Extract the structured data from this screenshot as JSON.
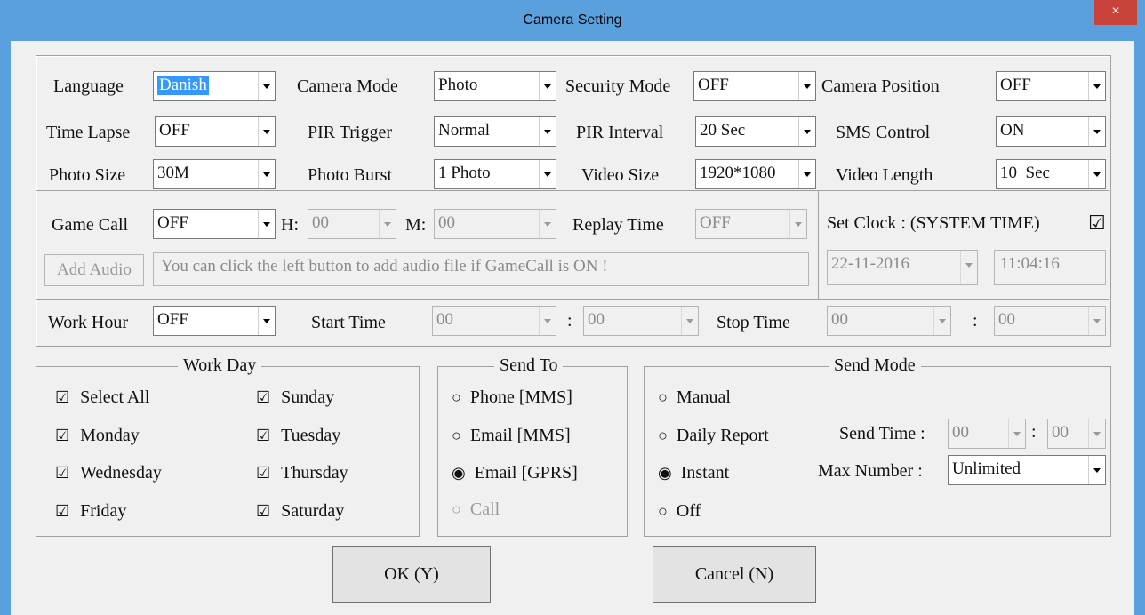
{
  "window": {
    "title": "Camera Setting",
    "close_glyph": "×"
  },
  "settings": {
    "language": {
      "label": "Language",
      "value": "Danish"
    },
    "camera_mode": {
      "label": "Camera Mode",
      "value": "Photo"
    },
    "security_mode": {
      "label": "Security Mode",
      "value": "OFF"
    },
    "camera_position": {
      "label": "Camera Position",
      "value": "OFF"
    },
    "time_lapse": {
      "label": "Time Lapse",
      "value": "OFF"
    },
    "pir_trigger": {
      "label": "PIR Trigger",
      "value": "Normal"
    },
    "pir_interval": {
      "label": "PIR Interval",
      "value": "20 Sec"
    },
    "sms_control": {
      "label": "SMS Control",
      "value": "ON"
    },
    "photo_size": {
      "label": "Photo Size",
      "value": "30M"
    },
    "photo_burst": {
      "label": "Photo Burst",
      "value": "1 Photo"
    },
    "video_size": {
      "label": "Video Size",
      "value": "1920*1080"
    },
    "video_length": {
      "label": "Video Length",
      "value": "10  Sec"
    }
  },
  "game_call": {
    "label": "Game Call",
    "value": "OFF",
    "h_label": "H:",
    "h_value": "00",
    "m_label": "M:",
    "m_value": "00",
    "replay_label": "Replay Time",
    "replay_value": "OFF",
    "add_audio_label": "Add Audio",
    "audio_hint": "You can click the left button to add audio file if GameCall is ON !"
  },
  "clock": {
    "label": "Set Clock  : (SYSTEM TIME)",
    "checkbox": "☑",
    "date": "22-11-2016",
    "time": "11:04:16"
  },
  "work_hour": {
    "label": "Work Hour",
    "value": "OFF",
    "start_label": "Start Time",
    "start_h": "00",
    "start_m": "00",
    "stop_label": "Stop Time",
    "stop_h": "00",
    "stop_m": "00",
    "colon": ":"
  },
  "work_day": {
    "title": "Work Day",
    "select_all": {
      "mark": "☑",
      "label": "Select All"
    },
    "days": [
      {
        "mark": "☑",
        "label": "Sunday"
      },
      {
        "mark": "☑",
        "label": "Monday"
      },
      {
        "mark": "☑",
        "label": "Tuesday"
      },
      {
        "mark": "☑",
        "label": "Wednesday"
      },
      {
        "mark": "☑",
        "label": "Thursday"
      },
      {
        "mark": "☑",
        "label": "Friday"
      },
      {
        "mark": "☑",
        "label": "Saturday"
      }
    ]
  },
  "send_to": {
    "title": "Send To",
    "options": [
      {
        "mark": "○",
        "label": "Phone [MMS]"
      },
      {
        "mark": "○",
        "label": "Email [MMS]"
      },
      {
        "mark": "◉",
        "label": "Email [GPRS]"
      },
      {
        "mark": "○",
        "label": "Call"
      }
    ]
  },
  "send_mode": {
    "title": "Send Mode",
    "options": [
      {
        "mark": "○",
        "label": "Manual"
      },
      {
        "mark": "○",
        "label": "Daily Report"
      },
      {
        "mark": "◉",
        "label": "Instant"
      },
      {
        "mark": "○",
        "label": "Off"
      }
    ],
    "send_time_label": "Send Time :",
    "send_time_h": "00",
    "send_time_m": "00",
    "max_number_label": "Max Number :",
    "max_number_value": "Unlimited"
  },
  "buttons": {
    "ok": "OK (Y)",
    "cancel": "Cancel (N)"
  }
}
